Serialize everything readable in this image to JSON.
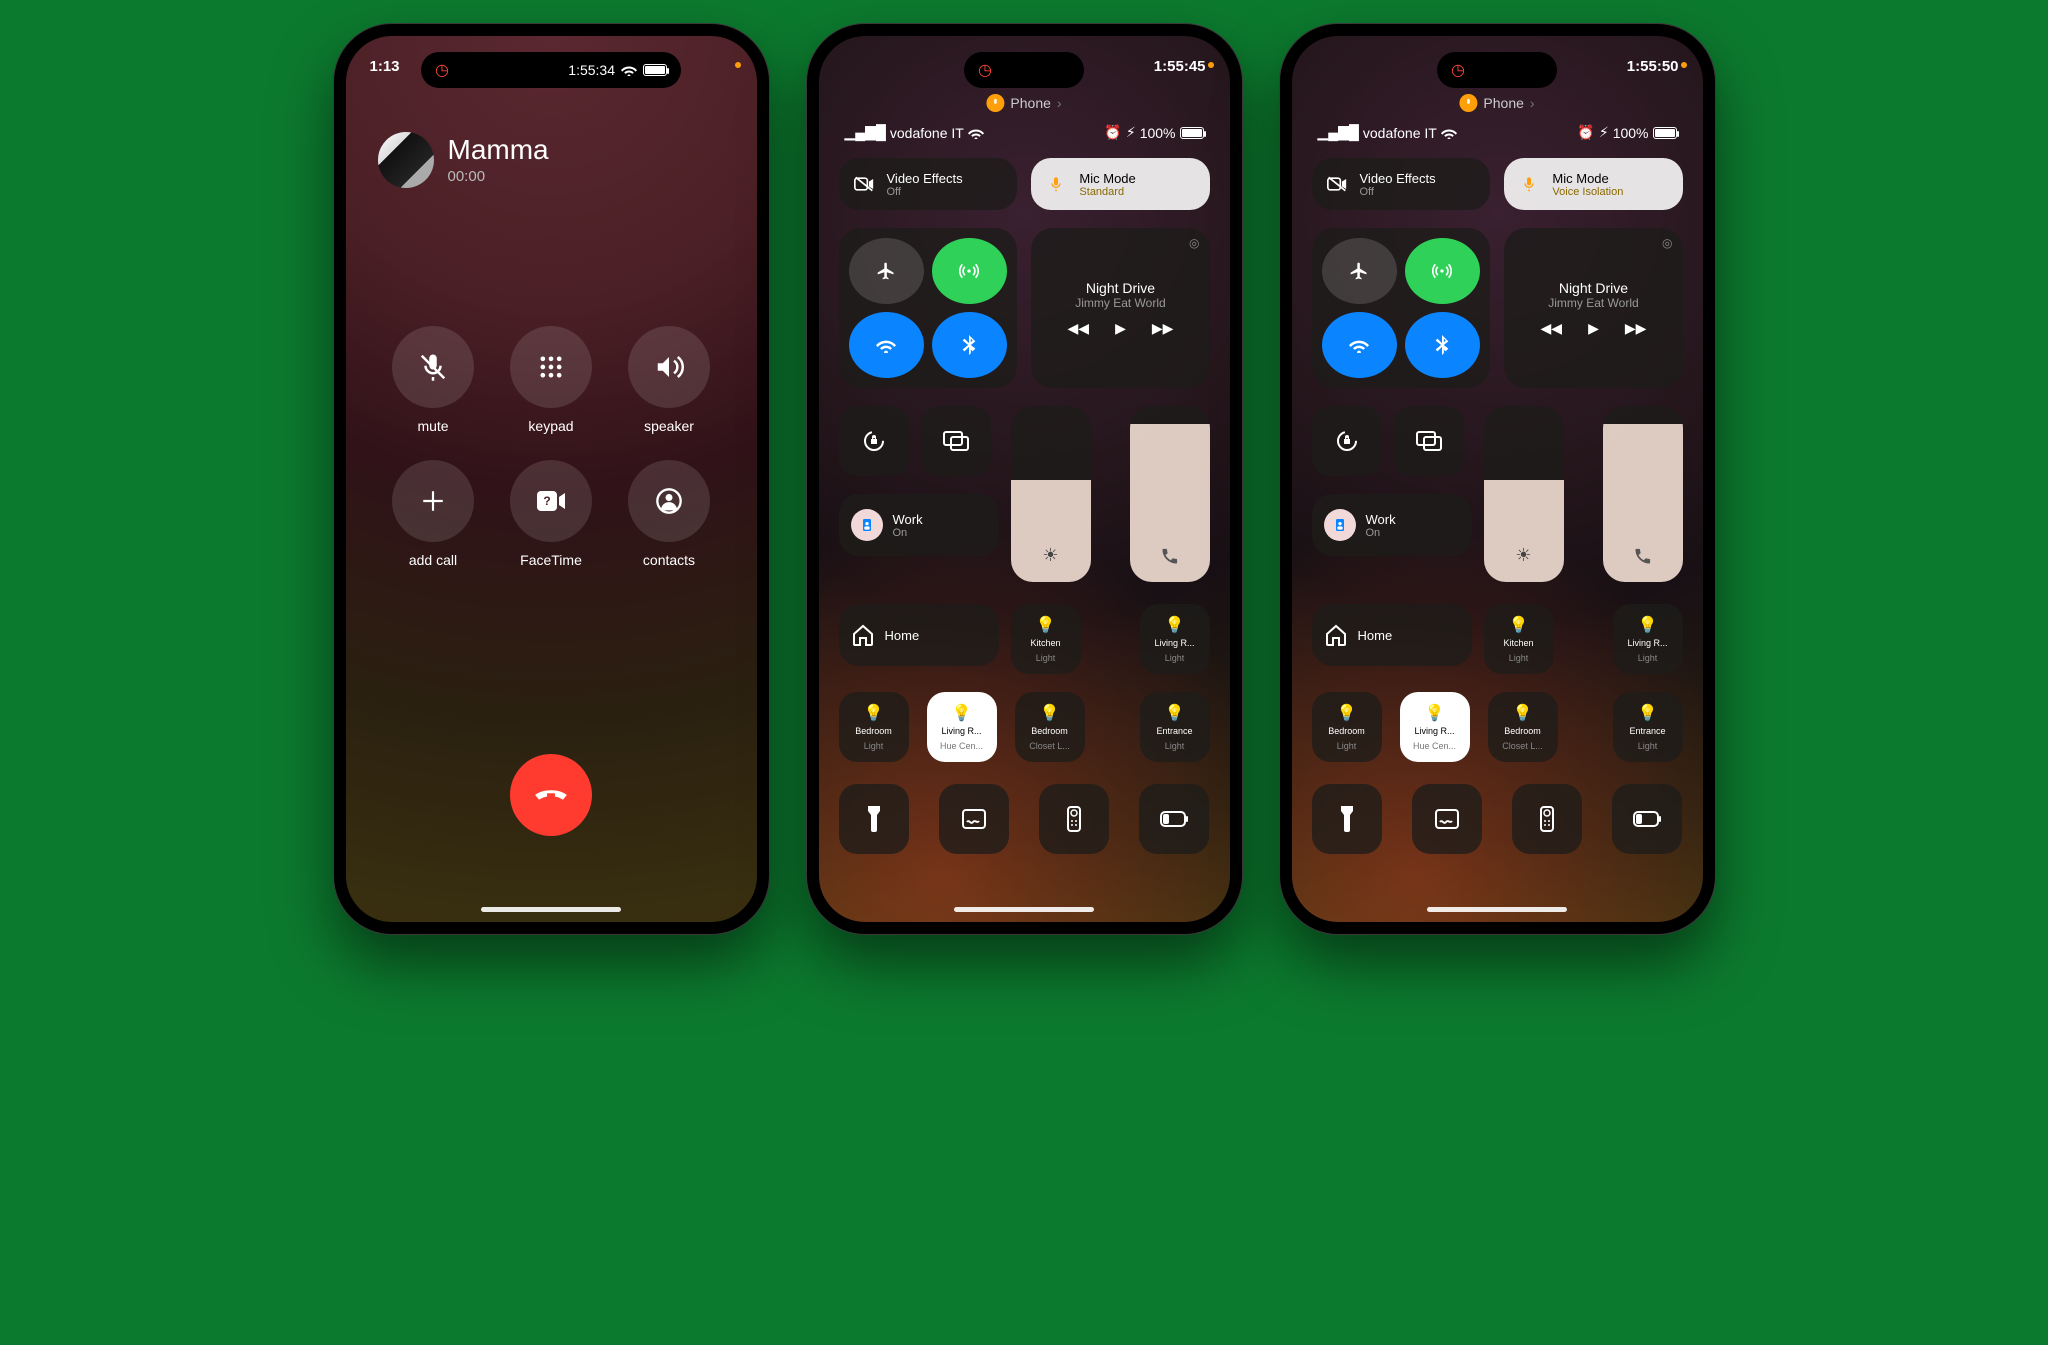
{
  "phone1": {
    "status": {
      "time_left": "1:13",
      "time_right": "1:55:34"
    },
    "caller": {
      "name": "Mamma",
      "duration": "00:00"
    },
    "buttons": {
      "mute": "mute",
      "keypad": "keypad",
      "speaker": "speaker",
      "add_call": "add call",
      "facetime": "FaceTime",
      "contacts": "contacts"
    }
  },
  "phone2": {
    "status": {
      "time_right": "1:55:45"
    },
    "pill_app": "Phone",
    "carrier": "vodafone IT",
    "battery_pct": "100%",
    "video_effects": {
      "title": "Video Effects",
      "sub": "Off"
    },
    "mic_mode": {
      "title": "Mic Mode",
      "sub": "Standard"
    },
    "media": {
      "song": "Night Drive",
      "artist": "Jimmy Eat World"
    },
    "focus": {
      "title": "Work",
      "sub": "On"
    },
    "home": {
      "title": "Home"
    },
    "lights": {
      "kitchen": {
        "l1": "Kitchen",
        "l2": "Light"
      },
      "living": {
        "l1": "Living R...",
        "l2": "Light"
      },
      "bedroom": {
        "l1": "Bedroom",
        "l2": "Light"
      },
      "hue": {
        "l1": "Living R...",
        "l2": "Hue Cen..."
      },
      "closet": {
        "l1": "Bedroom",
        "l2": "Closet L..."
      },
      "entrance": {
        "l1": "Entrance",
        "l2": "Light"
      }
    }
  },
  "phone3": {
    "status": {
      "time_right": "1:55:50"
    },
    "pill_app": "Phone",
    "carrier": "vodafone IT",
    "battery_pct": "100%",
    "video_effects": {
      "title": "Video Effects",
      "sub": "Off"
    },
    "mic_mode": {
      "title": "Mic Mode",
      "sub": "Voice Isolation"
    },
    "media": {
      "song": "Night Drive",
      "artist": "Jimmy Eat World"
    },
    "focus": {
      "title": "Work",
      "sub": "On"
    },
    "home": {
      "title": "Home"
    },
    "lights": {
      "kitchen": {
        "l1": "Kitchen",
        "l2": "Light"
      },
      "living": {
        "l1": "Living R...",
        "l2": "Light"
      },
      "bedroom": {
        "l1": "Bedroom",
        "l2": "Light"
      },
      "hue": {
        "l1": "Living R...",
        "l2": "Hue Cen..."
      },
      "closet": {
        "l1": "Bedroom",
        "l2": "Closet L..."
      },
      "entrance": {
        "l1": "Entrance",
        "l2": "Light"
      }
    }
  }
}
